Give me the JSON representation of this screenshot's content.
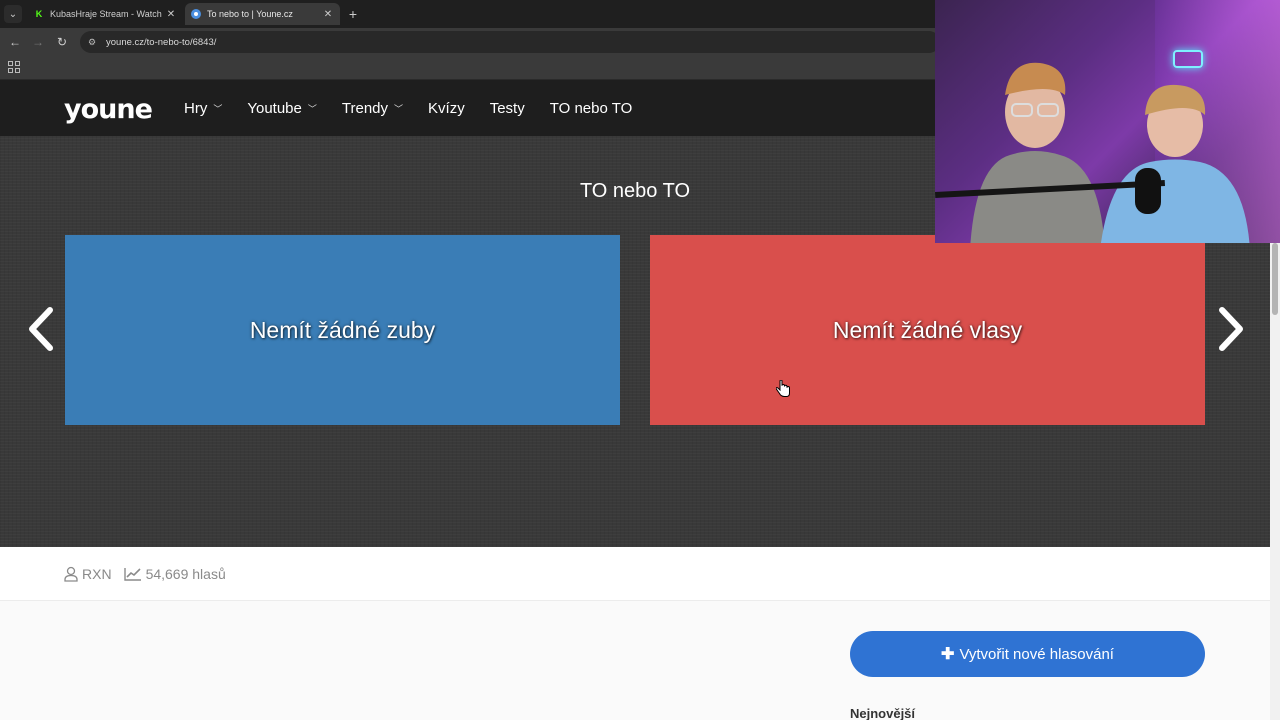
{
  "browser": {
    "tabs": [
      {
        "title": "KubasHraje Stream - Watch Live",
        "active": false,
        "favicon": "kick-icon"
      },
      {
        "title": "To nebo to | Youne.cz",
        "active": true,
        "favicon": "youne-icon"
      }
    ],
    "url": "youne.cz/to-nebo-to/6843/"
  },
  "site": {
    "logo": "youne",
    "nav": [
      {
        "label": "Hry",
        "dropdown": true
      },
      {
        "label": "Youtube",
        "dropdown": true
      },
      {
        "label": "Trendy",
        "dropdown": true
      },
      {
        "label": "Kvízy",
        "dropdown": false
      },
      {
        "label": "Testy",
        "dropdown": false
      },
      {
        "label": "TO nebo TO",
        "dropdown": false
      }
    ]
  },
  "game": {
    "title": "TO nebo TO",
    "option_left": "Nemít žádné zuby",
    "option_right": "Nemít žádné vlasy",
    "colors": {
      "left": "#3a7db6",
      "right": "#d94f4c"
    }
  },
  "stats": {
    "author": "RXN",
    "votes": "54,669 hlasů"
  },
  "sidebar": {
    "create_button": "Vytvořit nové hlasování",
    "newest_heading": "Nejnovější"
  }
}
